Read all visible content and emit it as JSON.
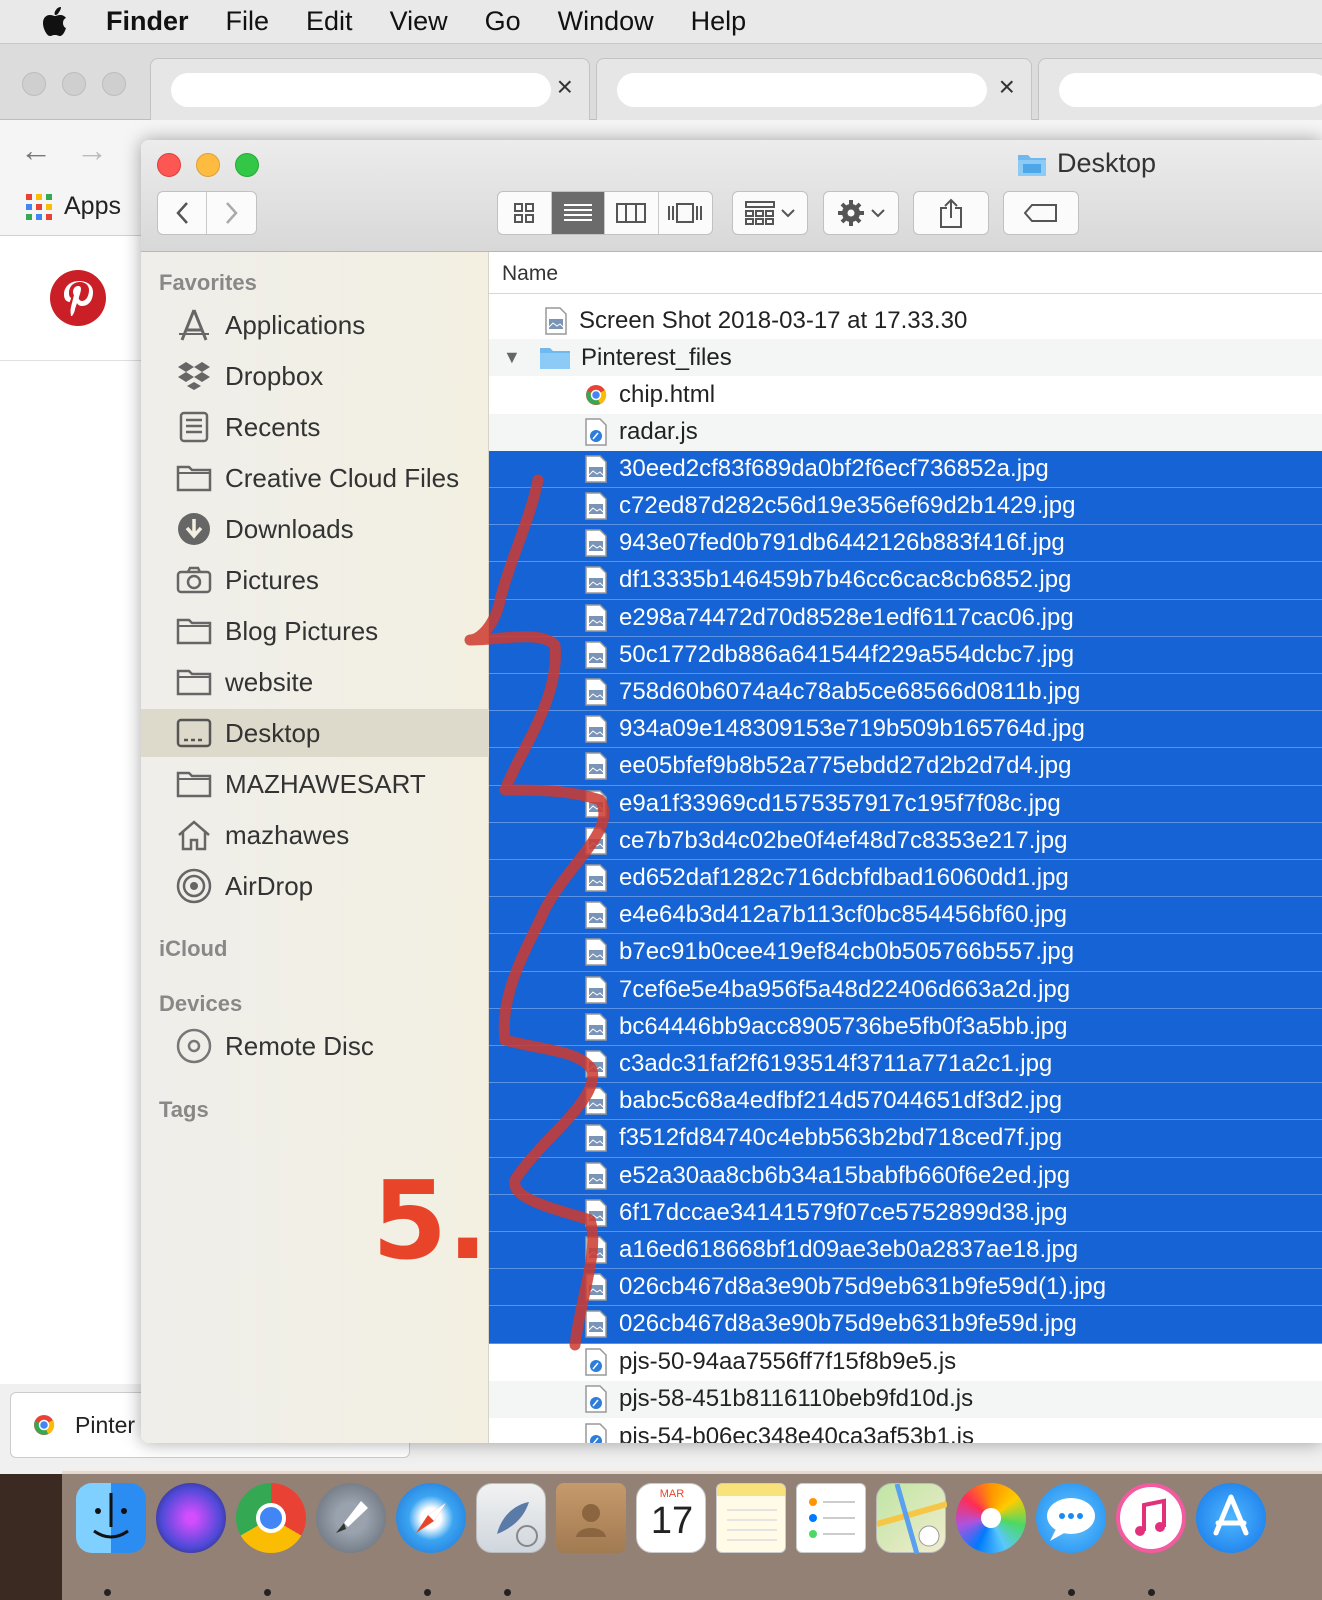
{
  "menubar": {
    "app": "Finder",
    "items": [
      "File",
      "Edit",
      "View",
      "Go",
      "Window",
      "Help"
    ]
  },
  "chrome": {
    "bookmark_apps": "Apps",
    "bottom_tab": "Pinter"
  },
  "finder": {
    "title": "Desktop",
    "column_name": "Name",
    "sidebar": {
      "favorites_header": "Favorites",
      "icloud_header": "iCloud",
      "devices_header": "Devices",
      "tags_header": "Tags",
      "favorites": [
        {
          "label": "Applications",
          "icon": "applications-icon"
        },
        {
          "label": "Dropbox",
          "icon": "dropbox-icon"
        },
        {
          "label": "Recents",
          "icon": "recents-icon"
        },
        {
          "label": "Creative Cloud Files",
          "icon": "folder-icon"
        },
        {
          "label": "Downloads",
          "icon": "downloads-icon"
        },
        {
          "label": "Pictures",
          "icon": "camera-icon"
        },
        {
          "label": "Blog Pictures",
          "icon": "folder-icon"
        },
        {
          "label": "website",
          "icon": "folder-icon"
        },
        {
          "label": "Desktop",
          "icon": "desktop-icon",
          "selected": true
        },
        {
          "label": "MAZHAWESART",
          "icon": "folder-icon"
        },
        {
          "label": "mazhawes",
          "icon": "home-icon"
        },
        {
          "label": "AirDrop",
          "icon": "airdrop-icon"
        }
      ],
      "devices": [
        {
          "label": "Remote Disc",
          "icon": "disc-icon"
        }
      ]
    },
    "files": [
      {
        "name": "Screen Shot 2018-03-17 at 17.33.30",
        "type": "image",
        "indent": 0
      },
      {
        "name": "Pinterest_files",
        "type": "folder",
        "indent": 0,
        "expanded": true
      },
      {
        "name": "chip.html",
        "type": "html",
        "indent": 1
      },
      {
        "name": "radar.js",
        "type": "js",
        "indent": 1
      },
      {
        "name": "30eed2cf83f689da0bf2f6ecf736852a.jpg",
        "type": "image",
        "indent": 1,
        "selected": true
      },
      {
        "name": "c72ed87d282c56d19e356ef69d2b1429.jpg",
        "type": "image",
        "indent": 1,
        "selected": true
      },
      {
        "name": "943e07fed0b791db6442126b883f416f.jpg",
        "type": "image",
        "indent": 1,
        "selected": true
      },
      {
        "name": "df13335b146459b7b46cc6cac8cb6852.jpg",
        "type": "image",
        "indent": 1,
        "selected": true
      },
      {
        "name": "e298a74472d70d8528e1edf6117cac06.jpg",
        "type": "image",
        "indent": 1,
        "selected": true
      },
      {
        "name": "50c1772db886a641544f229a554dcbc7.jpg",
        "type": "image",
        "indent": 1,
        "selected": true
      },
      {
        "name": "758d60b6074a4c78ab5ce68566d0811b.jpg",
        "type": "image",
        "indent": 1,
        "selected": true
      },
      {
        "name": "934a09e148309153e719b509b165764d.jpg",
        "type": "image",
        "indent": 1,
        "selected": true
      },
      {
        "name": "ee05bfef9b8b52a775ebdd27d2b2d7d4.jpg",
        "type": "image",
        "indent": 1,
        "selected": true
      },
      {
        "name": "e9a1f33969cd1575357917c195f7f08c.jpg",
        "type": "image",
        "indent": 1,
        "selected": true
      },
      {
        "name": "ce7b7b3d4c02be0f4ef48d7c8353e217.jpg",
        "type": "image",
        "indent": 1,
        "selected": true
      },
      {
        "name": "ed652daf1282c716dcbfdbad16060dd1.jpg",
        "type": "image",
        "indent": 1,
        "selected": true
      },
      {
        "name": "e4e64b3d412a7b113cf0bc854456bf60.jpg",
        "type": "image",
        "indent": 1,
        "selected": true
      },
      {
        "name": "b7ec91b0cee419ef84cb0b505766b557.jpg",
        "type": "image",
        "indent": 1,
        "selected": true
      },
      {
        "name": "7cef6e5e4ba956f5a48d22406d663a2d.jpg",
        "type": "image",
        "indent": 1,
        "selected": true
      },
      {
        "name": "bc64446bb9acc8905736be5fb0f3a5bb.jpg",
        "type": "image",
        "indent": 1,
        "selected": true
      },
      {
        "name": "c3adc31faf2f6193514f3711a771a2c1.jpg",
        "type": "image",
        "indent": 1,
        "selected": true
      },
      {
        "name": "babc5c68a4edfbf214d57044651df3d2.jpg",
        "type": "image",
        "indent": 1,
        "selected": true
      },
      {
        "name": "f3512fd84740c4ebb563b2bd718ced7f.jpg",
        "type": "image",
        "indent": 1,
        "selected": true
      },
      {
        "name": "e52a30aa8cb6b34a15babfb660f6e2ed.jpg",
        "type": "image",
        "indent": 1,
        "selected": true
      },
      {
        "name": "6f17dccae34141579f07ce5752899d38.jpg",
        "type": "image",
        "indent": 1,
        "selected": true
      },
      {
        "name": "a16ed618668bf1d09ae3eb0a2837ae18.jpg",
        "type": "image",
        "indent": 1,
        "selected": true
      },
      {
        "name": "026cb467d8a3e90b75d9eb631b9fe59d(1).jpg",
        "type": "image",
        "indent": 1,
        "selected": true
      },
      {
        "name": "026cb467d8a3e90b75d9eb631b9fe59d.jpg",
        "type": "image",
        "indent": 1,
        "selected": true
      },
      {
        "name": "pjs-50-94aa7556ff7f15f8b9e5.js",
        "type": "js",
        "indent": 1
      },
      {
        "name": "pjs-58-451b8116110beb9fd10d.js",
        "type": "js",
        "indent": 1
      },
      {
        "name": "pjs-54-b06ec348e40ca3af53b1.js",
        "type": "js",
        "indent": 1
      }
    ]
  },
  "annotation": {
    "text": "5.",
    "color": "#e8442a"
  },
  "dock": {
    "calendar_month": "MAR",
    "calendar_day": "17",
    "apps": [
      "finder",
      "siri",
      "chrome",
      "launchpad",
      "safari",
      "mail",
      "contacts",
      "calendar",
      "notes",
      "reminders",
      "maps",
      "photos",
      "messages",
      "itunes",
      "app-store"
    ]
  },
  "colors": {
    "selection": "#1563d4",
    "close": "#fc5753",
    "minimize": "#fdbc40",
    "zoom": "#33c748"
  }
}
